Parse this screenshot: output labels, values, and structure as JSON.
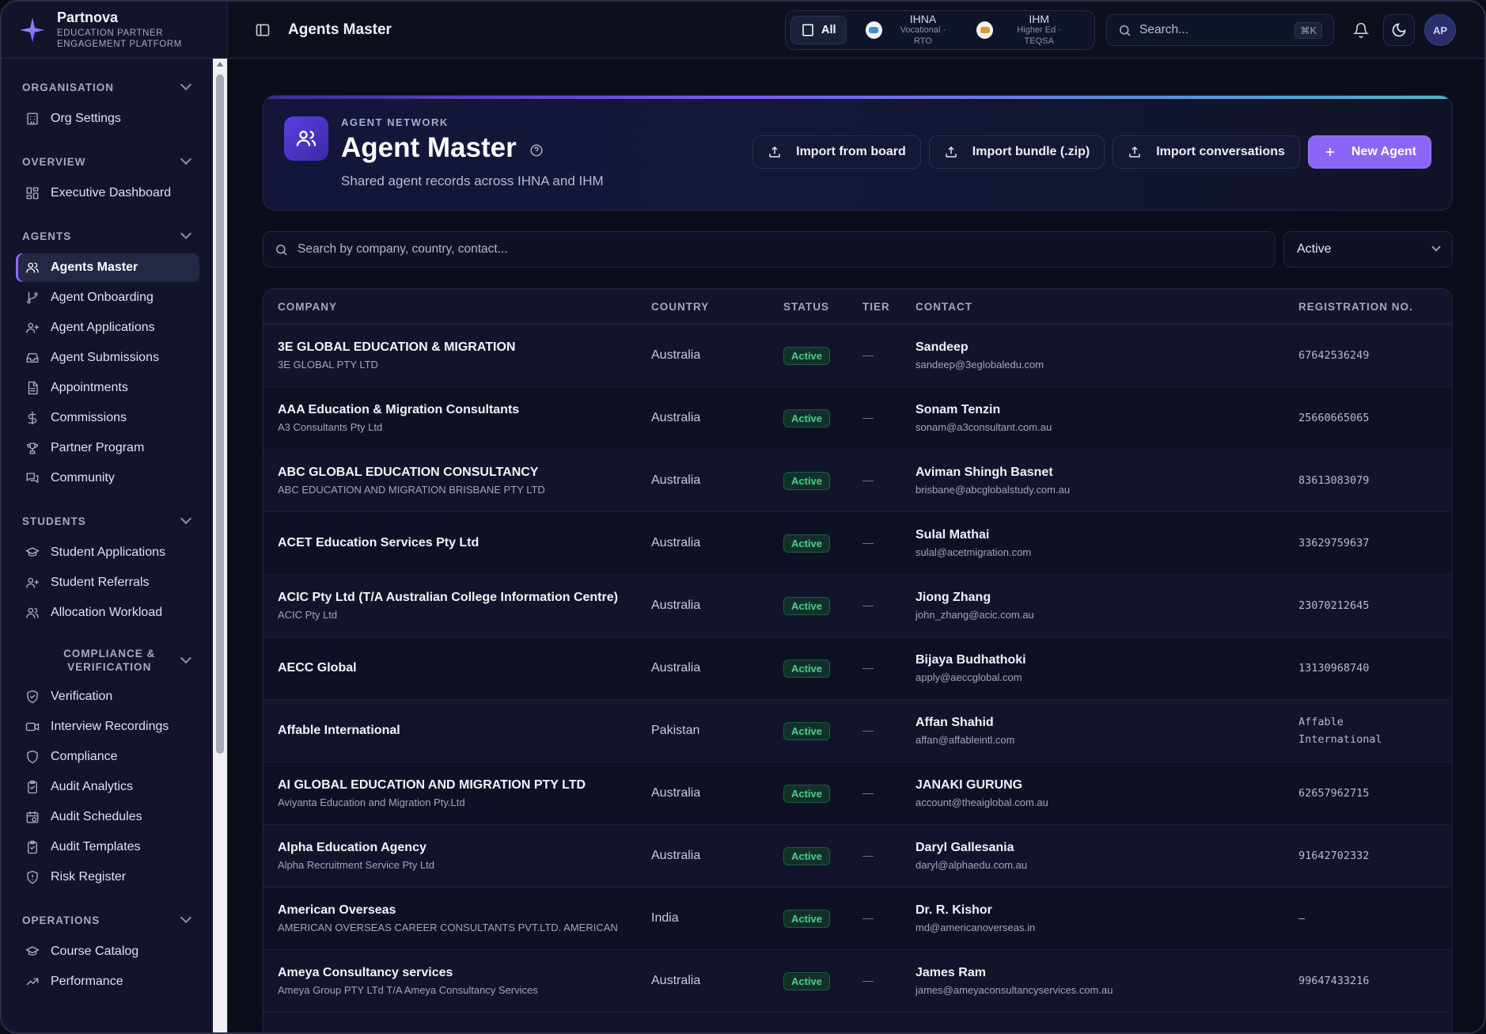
{
  "brand": {
    "name": "Partnova",
    "subtitle_line1": "EDUCATION PARTNER",
    "subtitle_line2": "ENGAGEMENT PLATFORM"
  },
  "sidebar": {
    "sections": [
      {
        "label": "ORGANISATION",
        "items": [
          {
            "label": "Org Settings",
            "icon": "building-icon"
          }
        ]
      },
      {
        "label": "OVERVIEW",
        "items": [
          {
            "label": "Executive Dashboard",
            "icon": "dashboard-icon"
          }
        ]
      },
      {
        "label": "AGENTS",
        "items": [
          {
            "label": "Agents Master",
            "icon": "users-icon",
            "active": true
          },
          {
            "label": "Agent Onboarding",
            "icon": "git-branch-icon"
          },
          {
            "label": "Agent Applications",
            "icon": "user-plus-icon"
          },
          {
            "label": "Agent Submissions",
            "icon": "inbox-icon"
          },
          {
            "label": "Appointments",
            "icon": "document-icon"
          },
          {
            "label": "Commissions",
            "icon": "dollar-icon"
          },
          {
            "label": "Partner Program",
            "icon": "trophy-icon"
          },
          {
            "label": "Community",
            "icon": "chat-icon"
          }
        ]
      },
      {
        "label": "STUDENTS",
        "items": [
          {
            "label": "Student Applications",
            "icon": "graduation-cap-icon"
          },
          {
            "label": "Student Referrals",
            "icon": "user-plus-icon"
          },
          {
            "label": "Allocation Workload",
            "icon": "users-icon"
          }
        ]
      },
      {
        "label": "COMPLIANCE & VERIFICATION",
        "label_line1": "COMPLIANCE &",
        "label_line2": "VERIFICATION",
        "items": [
          {
            "label": "Verification",
            "icon": "shield-check-icon"
          },
          {
            "label": "Interview Recordings",
            "icon": "video-icon"
          },
          {
            "label": "Compliance",
            "icon": "shield-icon"
          },
          {
            "label": "Audit Analytics",
            "icon": "clipboard-icon"
          },
          {
            "label": "Audit Schedules",
            "icon": "calendar-clock-icon"
          },
          {
            "label": "Audit Templates",
            "icon": "clipboard-icon"
          },
          {
            "label": "Risk Register",
            "icon": "warning-shield-icon"
          }
        ]
      },
      {
        "label": "OPERATIONS",
        "items": [
          {
            "label": "Course Catalog",
            "icon": "graduation-cap-icon"
          },
          {
            "label": "Performance",
            "icon": "trend-icon"
          }
        ]
      }
    ]
  },
  "topbar": {
    "title": "Agents Master",
    "tenant_all": "All",
    "tenants": [
      {
        "name": "IHNA",
        "sub": "Vocational · RTO",
        "color": "#3a8fd6"
      },
      {
        "name": "IHM",
        "sub": "Higher Ed · TEQSA",
        "color": "#e0962c"
      }
    ],
    "search_placeholder": "Search...",
    "search_shortcut": "⌘K",
    "avatar_initials": "AP"
  },
  "hero": {
    "kicker": "AGENT NETWORK",
    "title": "Agent Master",
    "subtitle": "Shared agent records across IHNA and IHM",
    "actions": {
      "import_board": "Import from board",
      "import_bundle": "Import bundle (.zip)",
      "import_conversations": "Import conversations",
      "new_agent": "New Agent"
    }
  },
  "filters": {
    "search_placeholder": "Search by company, country, contact...",
    "status_value": "Active"
  },
  "table": {
    "columns": {
      "company": "COMPANY",
      "country": "COUNTRY",
      "status": "STATUS",
      "tier": "TIER",
      "contact": "CONTACT",
      "registration": "REGISTRATION NO."
    },
    "rows": [
      {
        "company": "3E GLOBAL EDUCATION & MIGRATION",
        "legal": "3E GLOBAL PTY LTD",
        "country": "Australia",
        "status": "Active",
        "contact": "Sandeep",
        "email": "sandeep@3eglobaledu.com",
        "reg": "67642536249"
      },
      {
        "company": "AAA Education & Migration Consultants",
        "legal": "A3 Consultants Pty Ltd",
        "country": "Australia",
        "status": "Active",
        "contact": "Sonam Tenzin",
        "email": "sonam@a3consultant.com.au",
        "reg": "25660665065"
      },
      {
        "company": "ABC GLOBAL EDUCATION CONSULTANCY",
        "legal": "ABC EDUCATION AND MIGRATION BRISBANE PTY LTD",
        "country": "Australia",
        "status": "Active",
        "contact": "Aviman Shingh Basnet",
        "email": "brisbane@abcglobalstudy.com.au",
        "reg": "83613083079"
      },
      {
        "company": "ACET Education Services Pty Ltd",
        "legal": "",
        "country": "Australia",
        "status": "Active",
        "contact": "Sulal Mathai",
        "email": "sulal@acetmigration.com",
        "reg": "33629759637"
      },
      {
        "company": "ACIC Pty Ltd (T/A Australian College Information Centre)",
        "legal": "ACIC Pty Ltd",
        "country": "Australia",
        "status": "Active",
        "contact": "Jiong Zhang",
        "email": "john_zhang@acic.com.au",
        "reg": "23070212645"
      },
      {
        "company": "AECC Global",
        "legal": "",
        "country": "Australia",
        "status": "Active",
        "contact": "Bijaya Budhathoki",
        "email": "apply@aeccglobal.com",
        "reg": "13130968740"
      },
      {
        "company": "Affable International",
        "legal": "",
        "country": "Pakistan",
        "status": "Active",
        "contact": "Affan Shahid",
        "email": "affan@affableintl.com",
        "reg": "Affable International"
      },
      {
        "company": "AI GLOBAL EDUCATION AND MIGRATION PTY LTD",
        "legal": "Aviyanta Education and Migration Pty.Ltd",
        "country": "Australia",
        "status": "Active",
        "contact": "JANAKI GURUNG",
        "email": "account@theaiglobal.com.au",
        "reg": "62657962715"
      },
      {
        "company": "Alpha Education Agency",
        "legal": "Alpha Recruitment Service Pty Ltd",
        "country": "Australia",
        "status": "Active",
        "contact": "Daryl Gallesania",
        "email": "daryl@alphaedu.com.au",
        "reg": "91642702332"
      },
      {
        "company": "American Overseas",
        "legal": "AMERICAN OVERSEAS CAREER CONSULTANTS PVT.LTD. AMERICAN",
        "country": "India",
        "status": "Active",
        "contact": "Dr. R. Kishor",
        "email": "md@americanoverseas.in",
        "reg": "–"
      },
      {
        "company": "Ameya Consultancy services",
        "legal": "Ameya Group PTY LTd T/A Ameya Consultancy Services",
        "country": "Australia",
        "status": "Active",
        "contact": "James Ram",
        "email": "james@ameyaconsultancyservices.com.au",
        "reg": "99647433216"
      }
    ]
  }
}
